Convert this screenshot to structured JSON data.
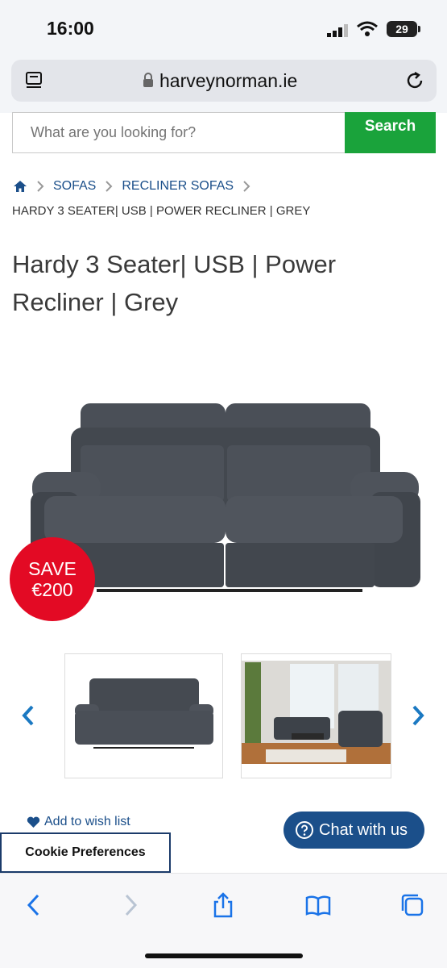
{
  "status_bar": {
    "time": "16:00",
    "battery": "29"
  },
  "browser": {
    "url": "harveynorman.ie"
  },
  "search": {
    "placeholder": "What are you looking for?",
    "button_label": "Search"
  },
  "breadcrumb": {
    "items": [
      "SOFAS",
      "RECLINER SOFAS"
    ],
    "current": "HARDY 3 SEATER| USB | POWER RECLINER | GREY"
  },
  "product": {
    "title": "Hardy 3 Seater| USB | Power Recliner | Grey",
    "save_badge": {
      "line1": "SAVE",
      "line2": "€200"
    }
  },
  "actions": {
    "wishlist": "Add to wish list",
    "chat": "Chat with us",
    "cookie": "Cookie Preferences"
  },
  "colors": {
    "brand_blue": "#1b4f8a",
    "search_green": "#1aa33b",
    "save_red": "#e30a24"
  },
  "icons": [
    "tabs-icon",
    "lock-icon",
    "reload-icon",
    "home-icon",
    "chevron-left-icon",
    "chevron-right-icon",
    "heart-icon",
    "question-icon",
    "back-icon",
    "forward-icon",
    "share-icon",
    "bookmarks-icon",
    "tabs-overview-icon"
  ]
}
